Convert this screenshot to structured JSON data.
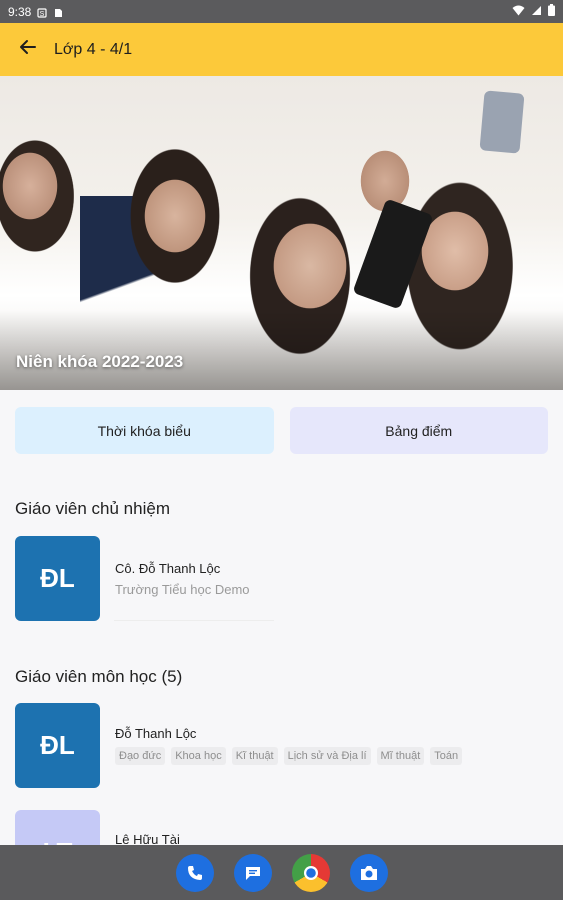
{
  "status_bar": {
    "time": "9:38"
  },
  "app_bar": {
    "title": "Lớp 4 - 4/1"
  },
  "hero": {
    "caption": "Niên khóa 2022-2023"
  },
  "actions": {
    "timetable_label": "Thời khóa biểu",
    "scores_label": "Bảng điểm"
  },
  "homeroom": {
    "section_title": "Giáo viên chủ nhiệm",
    "teacher": {
      "initials": "ĐL",
      "name": "Cô. Đỗ Thanh Lộc",
      "school": "Trường Tiểu học Demo"
    }
  },
  "subject_teachers": {
    "section_title": "Giáo viên môn học (5)",
    "items": [
      {
        "initials": "ĐL",
        "name": "Đỗ Thanh Lộc",
        "subjects": [
          "Đạo đức",
          "Khoa học",
          "Kĩ thuật",
          "Lịch sử và Địa lí",
          "Mĩ thuật",
          "Toán"
        ]
      },
      {
        "initials": "LT",
        "name": "Lê Hữu Tài"
      }
    ]
  },
  "colors": {
    "app_bar": "#fcc93a",
    "avatar_primary": "#1d72b0",
    "avatar_secondary": "#c5c9f6",
    "timetable_bg": "#dcf0fe",
    "scores_bg": "#e6e7fb"
  },
  "icons": {
    "back": "arrow-left-icon",
    "dock": [
      "phone-icon",
      "messages-icon",
      "chrome-icon",
      "camera-icon"
    ]
  }
}
